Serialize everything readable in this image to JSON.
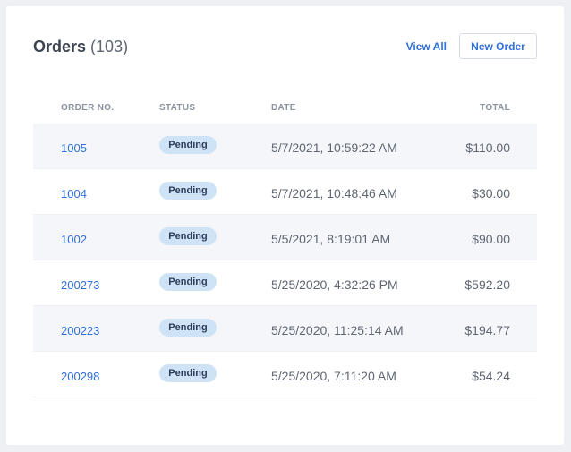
{
  "header": {
    "title": "Orders",
    "count": "(103)",
    "view_all": "View All",
    "new_order": "New Order"
  },
  "table": {
    "columns": [
      "ORDER NO.",
      "STATUS",
      "DATE",
      "TOTAL"
    ],
    "rows": [
      {
        "order_no": "1005",
        "status": "Pending",
        "date": "5/7/2021, 10:59:22 AM",
        "total": "$110.00"
      },
      {
        "order_no": "1004",
        "status": "Pending",
        "date": "5/7/2021, 10:48:46 AM",
        "total": "$30.00"
      },
      {
        "order_no": "1002",
        "status": "Pending",
        "date": "5/5/2021, 8:19:01 AM",
        "total": "$90.00"
      },
      {
        "order_no": "200273",
        "status": "Pending",
        "date": "5/25/2020, 4:32:26 PM",
        "total": "$592.20"
      },
      {
        "order_no": "200223",
        "status": "Pending",
        "date": "5/25/2020, 11:25:14 AM",
        "total": "$194.77"
      },
      {
        "order_no": "200298",
        "status": "Pending",
        "date": "5/25/2020, 7:11:20 AM",
        "total": "$54.24"
      }
    ]
  },
  "colors": {
    "accent": "#2f6fdb",
    "badge_bg": "#cfe3f7",
    "row_shade": "#f4f6fa",
    "page_bg": "#eef0f4"
  }
}
